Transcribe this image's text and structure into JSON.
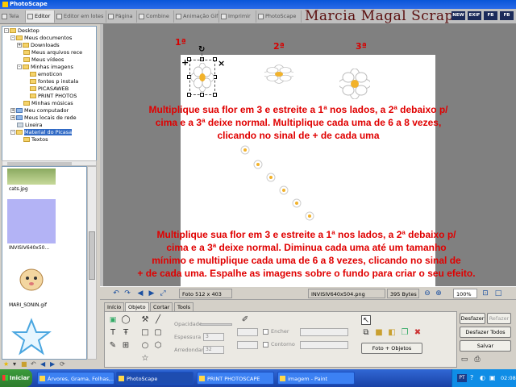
{
  "window": {
    "title": "PhotoScape"
  },
  "tabs": [
    {
      "label": "Tela"
    },
    {
      "label": "Editor"
    },
    {
      "label": "Editor em lotes"
    },
    {
      "label": "Página"
    },
    {
      "label": "Combine"
    },
    {
      "label": "Animação Gif"
    },
    {
      "label": "Imprimir"
    },
    {
      "label": "PhotoScape"
    }
  ],
  "watermark": "Marcia Magal Scraps",
  "brand_boxes": [
    "NEW",
    "EXIF",
    "FB",
    "FB"
  ],
  "tree": {
    "items": [
      {
        "label": "Desktop",
        "expander": "-"
      },
      {
        "label": "Meus documentos",
        "expander": "-"
      },
      {
        "label": "Downloads",
        "expander": "+"
      },
      {
        "label": "Meus arquivos rece",
        "expander": ""
      },
      {
        "label": "Meus vídeos",
        "expander": ""
      },
      {
        "label": "Minhas imagens",
        "expander": "-"
      },
      {
        "label": "emoticon",
        "expander": ""
      },
      {
        "label": "fontes p instala",
        "expander": ""
      },
      {
        "label": "PICASAWEB",
        "expander": ""
      },
      {
        "label": "PRINT PHOTOS",
        "expander": ""
      },
      {
        "label": "Minhas músicas",
        "expander": ""
      },
      {
        "label": "Meu computador",
        "expander": "+"
      },
      {
        "label": "Meus locais de rede",
        "expander": "+"
      },
      {
        "label": "Lixeira",
        "expander": ""
      },
      {
        "label": "Material do Picasa",
        "expander": "-"
      },
      {
        "label": "Textos",
        "expander": ""
      }
    ]
  },
  "thumbnails": [
    {
      "caption": "cats.jpg"
    },
    {
      "caption": "INVISIV640x50..."
    },
    {
      "caption": "MARI_SONIN.gif"
    }
  ],
  "canvas": {
    "labels": [
      "1ª",
      "2ª",
      "3ª"
    ],
    "text_top": [
      "Multiplique sua flor em 3  e estreite a 1ª nos lados, a 2ª debaixo p/",
      "cima e a 3ª deixe normal. Multiplique cada uma de 6 a 8 vezes,",
      "clicando no sinal de + de cada uma"
    ],
    "text_bottom": [
      "Multiplique sua flor em 3  e estreite a 1ª nos lados, a 2ª debaixo p/",
      "cima e a 3ª deixe normal. Diminua cada uma até um tamanho",
      "mínimo e multiplique cada uma de 6 a 8 vezes, clicando no sinal de",
      "+ de cada uma. Espalhe as imagens sobre o fundo para criar o seu efeito."
    ],
    "plus_symbol": "+",
    "close_symbol": "×"
  },
  "statusbar": {
    "photo_size": "Foto 512 x 403",
    "filename": "INVISIV640x504.png",
    "filesize": "395 Bytes",
    "zoom": "100%"
  },
  "bottom_tabs": [
    "Início",
    "Objeto",
    "Cortar",
    "Tools"
  ],
  "object_panel": {
    "opacity_label": "Opacidade",
    "thickness_label": "Espessura",
    "thickness_value": "3",
    "radius_label": "Arredondar",
    "radius_value": "32",
    "fill_label": "Encher",
    "outline_label": "Contorno",
    "photo_objects_button": "Foto + Objetos"
  },
  "actions": {
    "undo": "Desfazer",
    "redo": "Refazer",
    "undo_all": "Desfazer Todos",
    "save": "Salvar"
  },
  "taskbar": {
    "start": "Iniciar",
    "tasks": [
      {
        "label": "Árvores, Grama, Folhas,..."
      },
      {
        "label": "PhotoScape"
      },
      {
        "label": "PRINT PHOTOSCAPE"
      },
      {
        "label": "imagem - Paint"
      }
    ],
    "tray_lang": "PT",
    "clock": "02:08"
  }
}
